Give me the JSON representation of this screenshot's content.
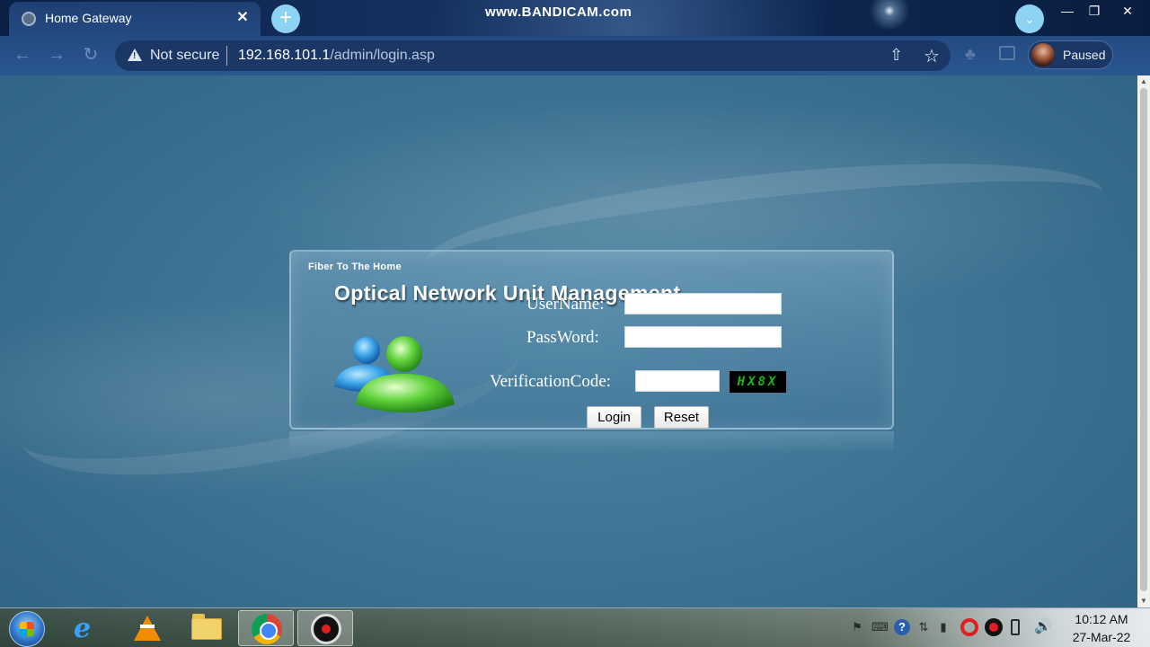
{
  "browser": {
    "tab_title": "Home Gateway",
    "tab_close_glyph": "✕",
    "new_tab_glyph": "+",
    "watermark": "www.BANDICAM.com",
    "security_label": "Not secure",
    "url_host": "192.168.101.1",
    "url_path": "/admin/login.asp",
    "profile_status": "Paused",
    "icons": {
      "favicon": "globe-icon",
      "back": "arrow-left-icon",
      "forward": "arrow-right-icon",
      "reload": "reload-icon",
      "security": "warning-icon",
      "share": "share-icon",
      "bookmark": "star-icon",
      "extensions": "puzzle-icon",
      "side_panel": "side-panel-icon",
      "tab_search": "chevron-down-icon"
    }
  },
  "login": {
    "subtitle": "Fiber To The Home",
    "title": "Optical Network Unit Management",
    "username_label": "UserName:",
    "username_value": "",
    "password_label": "PassWord:",
    "password_value": "",
    "verification_label": "VerificationCode:",
    "verification_value": "",
    "captcha": "HX8X",
    "login_button": "Login",
    "reset_button": "Reset",
    "captcha_color": "#16b816",
    "icon": "users-icon"
  },
  "taskbar": {
    "apps": [
      "start-orb",
      "internet-explorer",
      "vlc",
      "file-explorer",
      "chrome",
      "bandicam"
    ],
    "active_app": "chrome",
    "clock_time": "10:12 AM",
    "clock_date": "27-Mar-22",
    "tray_icons": [
      "flag-icon",
      "keyboard-icon",
      "help-icon",
      "ime-icon",
      "signal-icon",
      "opera-icon",
      "record-icon",
      "battery-icon",
      "volume-icon"
    ]
  },
  "colors": {
    "page_background": "#3f7494",
    "browser_frame": "#234a82",
    "accent_button": "#8dd4f4"
  }
}
